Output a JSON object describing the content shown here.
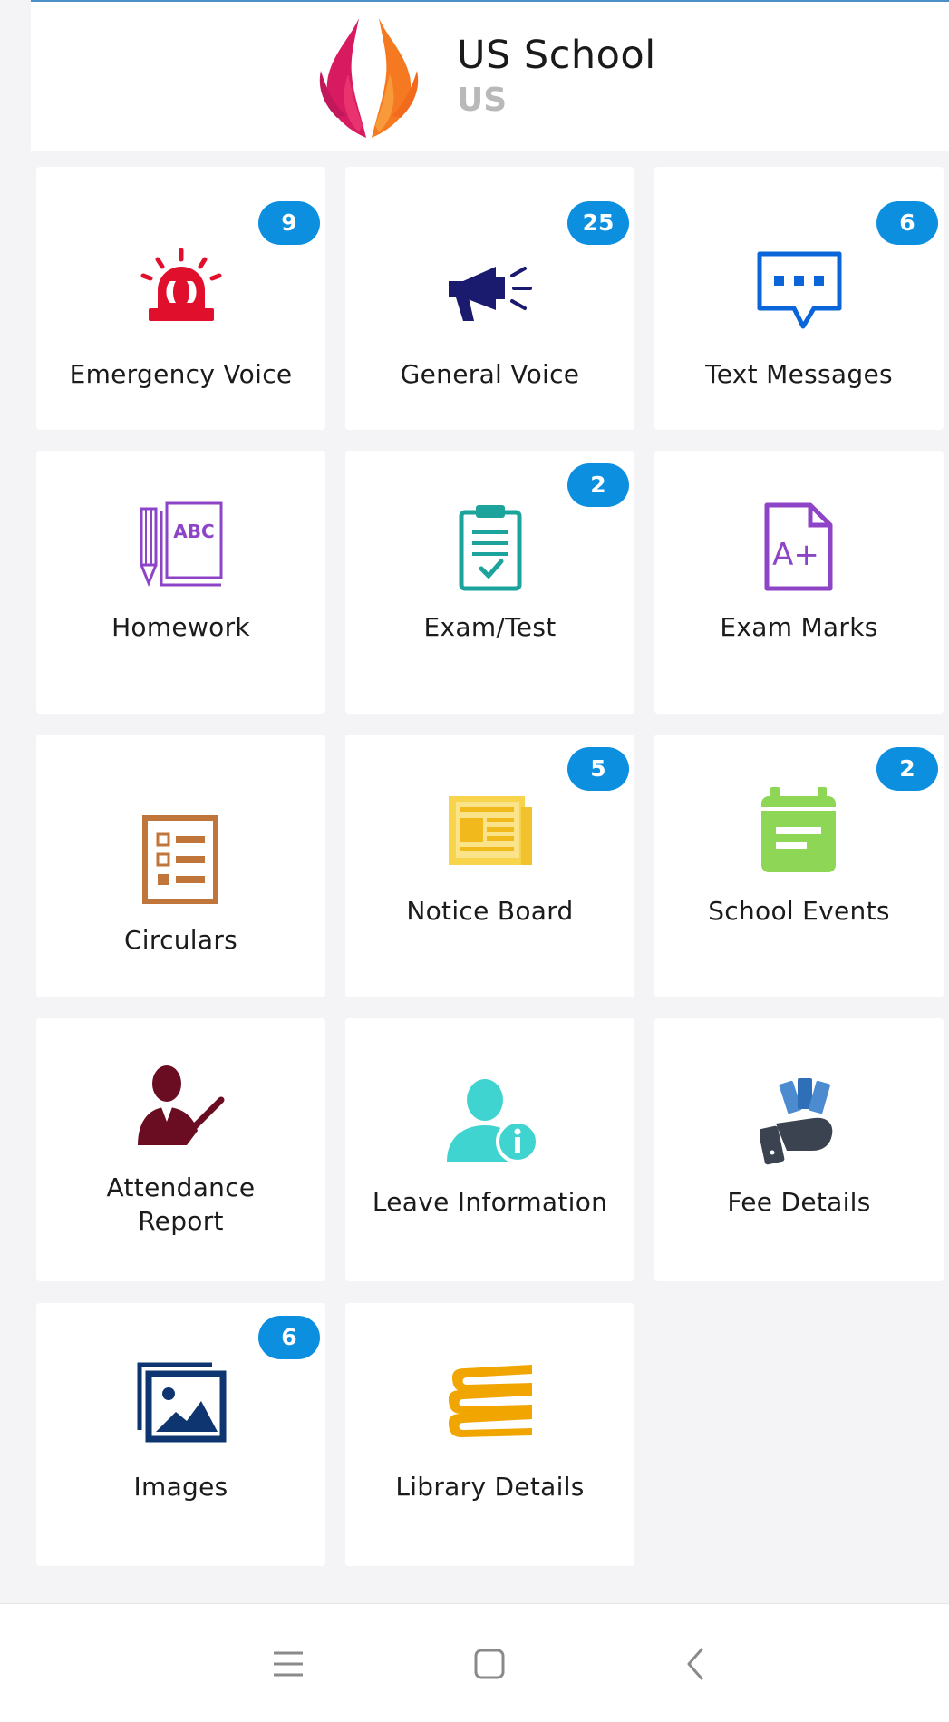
{
  "header": {
    "school_name": "US School",
    "school_code": "US",
    "logo_colors": [
      "#d81b60",
      "#f47920"
    ]
  },
  "tiles": [
    {
      "label": "Emergency Voice",
      "badge": "9",
      "icon": "siren-icon",
      "color": "#e0102c"
    },
    {
      "label": "General Voice",
      "badge": "25",
      "icon": "megaphone-icon",
      "color": "#1a1a6e"
    },
    {
      "label": "Text Messages",
      "badge": "6",
      "icon": "chat-bubble-icon",
      "color": "#0a66d8"
    },
    {
      "label": "Homework",
      "icon": "book-pencil-icon",
      "icon_text": "ABC",
      "color": "#8e44c6"
    },
    {
      "label": "Exam/Test",
      "badge": "2",
      "icon": "clipboard-check-icon",
      "color": "#1ba39c"
    },
    {
      "label": "Exam Marks",
      "icon": "grade-document-icon",
      "icon_text": "A+",
      "color": "#8e44c6"
    },
    {
      "label": "Circulars",
      "icon": "checklist-icon",
      "color": "#c0763a"
    },
    {
      "label": "Notice Board",
      "badge": "5",
      "icon": "newspaper-icon",
      "color": "#f7d44c"
    },
    {
      "label": "School Events",
      "badge": "2",
      "icon": "calendar-icon",
      "color": "#8ed655"
    },
    {
      "label": "Attendance Report",
      "icon": "person-check-icon",
      "color": "#6b0d22"
    },
    {
      "label": "Leave Information",
      "icon": "person-info-icon",
      "color": "#3fd4d0"
    },
    {
      "label": "Fee Details",
      "icon": "money-hand-icon",
      "color": "#3b4350"
    },
    {
      "label": "Images",
      "badge": "6",
      "icon": "image-gallery-icon",
      "color": "#0e3570"
    },
    {
      "label": "Library Details",
      "icon": "books-stack-icon",
      "color": "#f0a500"
    }
  ],
  "navbar": {
    "buttons": [
      "menu-icon",
      "home-square-icon",
      "back-chevron-icon"
    ]
  }
}
